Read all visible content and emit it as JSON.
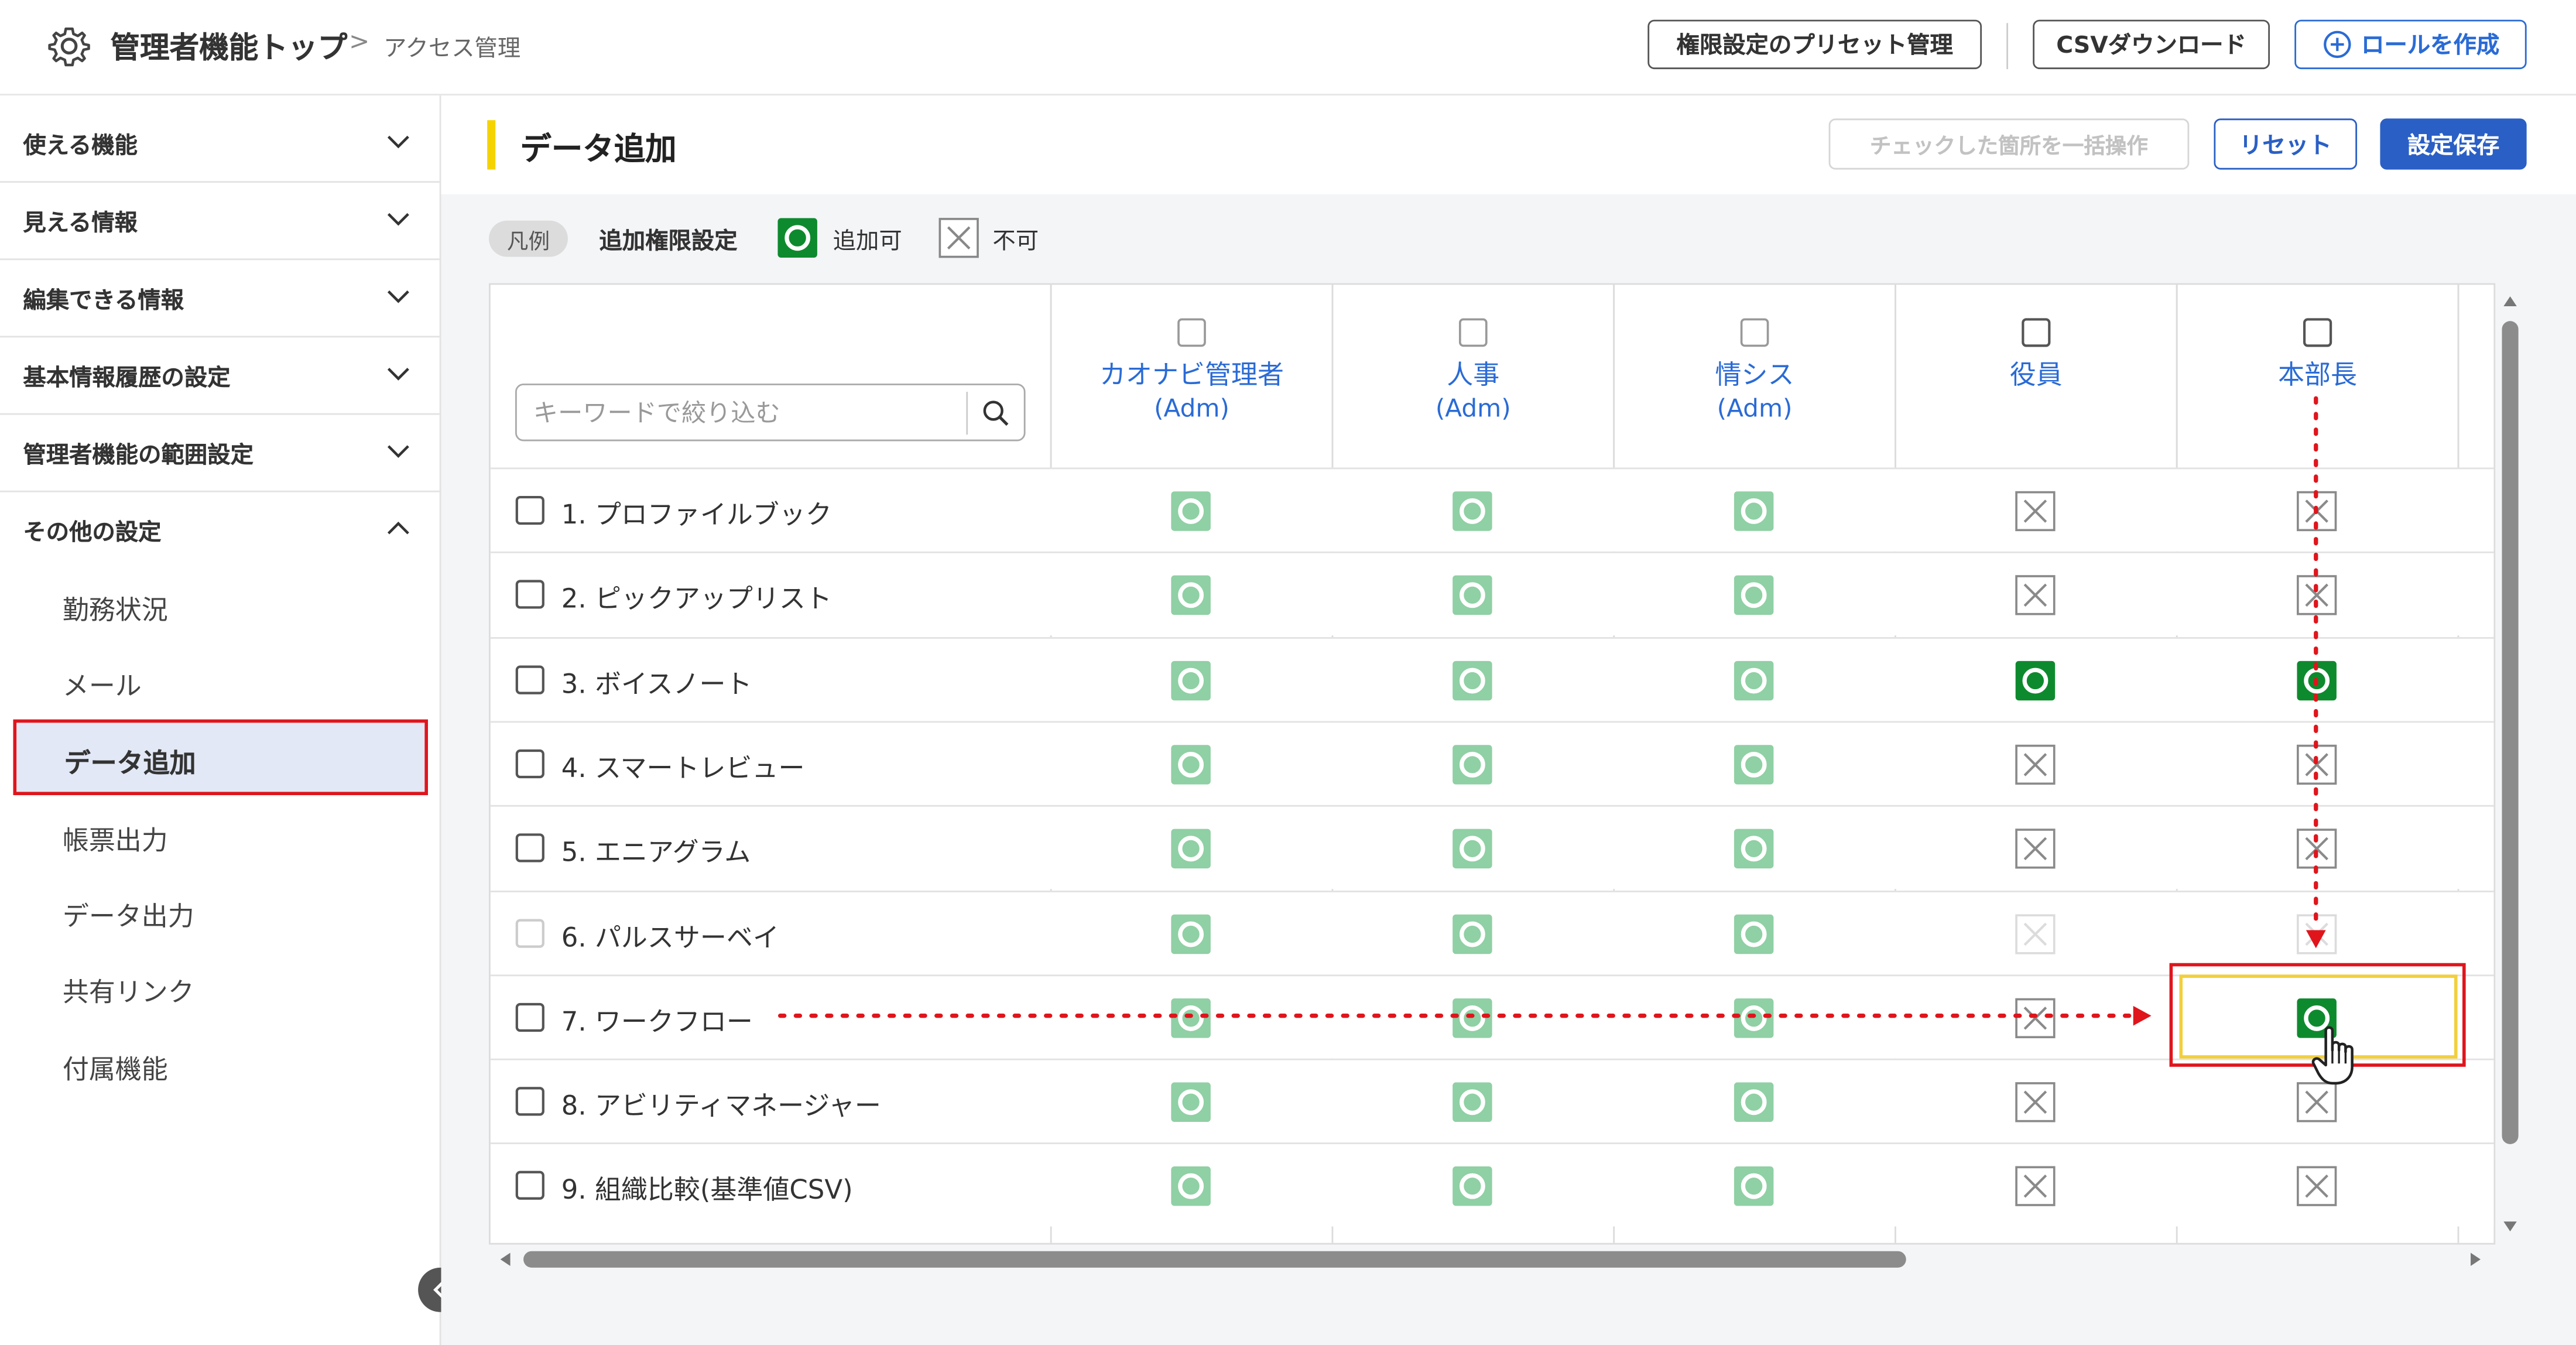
{
  "header": {
    "title": "管理者機能トップ",
    "separator": ">",
    "breadcrumb": "アクセス管理",
    "buttons": {
      "preset": "権限設定のプリセット管理",
      "csv": "CSVダウンロード",
      "create_role": "ロールを作成"
    }
  },
  "sidebar": {
    "sections": [
      {
        "label": "使える機能",
        "expanded": false
      },
      {
        "label": "見える情報",
        "expanded": false
      },
      {
        "label": "編集できる情報",
        "expanded": false
      },
      {
        "label": "基本情報履歴の設定",
        "expanded": false
      },
      {
        "label": "管理者機能の範囲設定",
        "expanded": false
      },
      {
        "label": "その他の設定",
        "expanded": true
      }
    ],
    "sub_items": [
      "勤務状況",
      "メール",
      "データ追加",
      "帳票出力",
      "データ出力",
      "共有リンク",
      "付属機能"
    ],
    "active_item": "データ追加"
  },
  "main": {
    "title": "データ追加",
    "buttons": {
      "batch": "チェックした箇所を一括操作",
      "reset": "リセット",
      "save": "設定保存"
    },
    "legend": {
      "pill": "凡例",
      "title": "追加権限設定",
      "allowed": "追加可",
      "denied": "不可"
    },
    "search_placeholder": "キーワードで絞り込む",
    "columns": [
      {
        "name": "カオナビ管理者",
        "sub": "(Adm)"
      },
      {
        "name": "人事",
        "sub": "(Adm)"
      },
      {
        "name": "情シス",
        "sub": "(Adm)"
      },
      {
        "name": "役員",
        "sub": ""
      },
      {
        "name": "本部長",
        "sub": ""
      }
    ],
    "rows": [
      {
        "label": "1. プロファイルブック",
        "cells": [
          "ok-light",
          "ok-light",
          "ok-light",
          "ng",
          "ng"
        ]
      },
      {
        "label": "2. ピックアップリスト",
        "cells": [
          "ok-light",
          "ok-light",
          "ok-light",
          "ng",
          "ng"
        ]
      },
      {
        "label": "3. ボイスノート",
        "cells": [
          "ok-light",
          "ok-light",
          "ok-light",
          "ok",
          "ok"
        ]
      },
      {
        "label": "4. スマートレビュー",
        "cells": [
          "ok-light",
          "ok-light",
          "ok-light",
          "ng",
          "ng"
        ]
      },
      {
        "label": "5. エニアグラム",
        "cells": [
          "ok-light",
          "ok-light",
          "ok-light",
          "ng",
          "ng"
        ]
      },
      {
        "label": "6. パルスサーベイ",
        "cells": [
          "ok-light",
          "ok-light",
          "ok-light",
          "ng-disabled",
          "ng-disabled"
        ]
      },
      {
        "label": "7. ワークフロー",
        "cells": [
          "ok-light",
          "ok-light",
          "ok-light",
          "ng",
          "ok"
        ]
      },
      {
        "label": "8. アビリティマネージャー",
        "cells": [
          "ok-light",
          "ok-light",
          "ok-light",
          "ng",
          "ng"
        ]
      },
      {
        "label": "9. 組織比較(基準値CSV)",
        "cells": [
          "ok-light",
          "ok-light",
          "ok-light",
          "ng",
          "ng"
        ]
      }
    ]
  },
  "colors": {
    "accent_blue": "#2a5fc5",
    "ok_dark": "#0e8a2e",
    "ok_light": "#8fd0a4",
    "highlight_red": "#e0151c",
    "highlight_yellow": "#f2cf3c"
  },
  "icons": [
    "gear-icon",
    "chevron-down-icon",
    "chevron-up-icon",
    "search-icon",
    "plus-circle-icon",
    "hand-cursor-icon",
    "collapse-arrow-icon"
  ]
}
